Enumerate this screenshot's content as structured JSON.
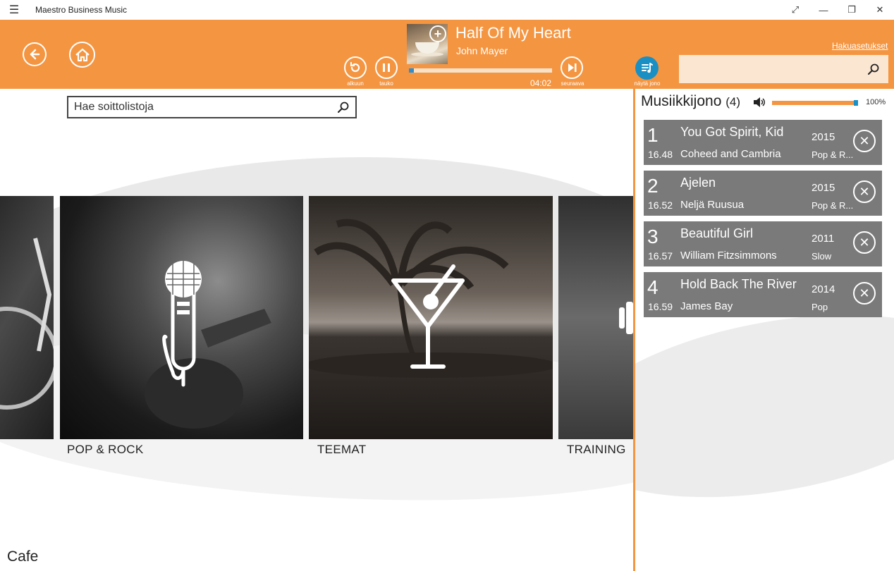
{
  "app": {
    "title": "Maestro Business Music"
  },
  "window_controls": {
    "menu_icon": "hamburger-icon",
    "fullscreen_icon": "expand-icon",
    "minimize_icon": "minimize-icon",
    "restore_icon": "restore-icon",
    "close_icon": "close-icon"
  },
  "colors": {
    "accent": "#f49541",
    "queue_item_bg": "#7a7a7a",
    "progress": "#2a8fd1",
    "queue_button": "#1a8fc4"
  },
  "now_playing": {
    "title": "Half Of My Heart",
    "artist": "John Mayer",
    "time": "04:02",
    "progress": 0.02
  },
  "controls": {
    "restart_label": "alkuun",
    "pause_label": "tauko",
    "next_label": "seuraava",
    "queue_label": "näytä jono"
  },
  "search": {
    "settings_link": "Hakuasetukset",
    "placeholder": ""
  },
  "main": {
    "playlist_search_placeholder": "Hae soittolistoja",
    "tiles": [
      {
        "label": "POP & ROCK"
      },
      {
        "label": "TEEMAT"
      },
      {
        "label": "TRAINING"
      }
    ],
    "section_label": "Cafe"
  },
  "queue": {
    "title": "Musiikkijono",
    "count": "(4)",
    "volume": "100%",
    "volume_level": 1.0,
    "items": [
      {
        "num": "1",
        "time": "16.48",
        "title": "You Got Spirit, Kid",
        "artist": "Coheed and Cambria",
        "year": "2015",
        "genre": "Pop & R..."
      },
      {
        "num": "2",
        "time": "16.52",
        "title": "Ajelen",
        "artist": "Neljä Ruusua",
        "year": "2015",
        "genre": "Pop & R..."
      },
      {
        "num": "3",
        "time": "16.57",
        "title": "Beautiful Girl",
        "artist": "William Fitzsimmons",
        "year": "2011",
        "genre": "Slow"
      },
      {
        "num": "4",
        "time": "16.59",
        "title": "Hold Back The River",
        "artist": "James Bay",
        "year": "2014",
        "genre": "Pop"
      }
    ]
  }
}
